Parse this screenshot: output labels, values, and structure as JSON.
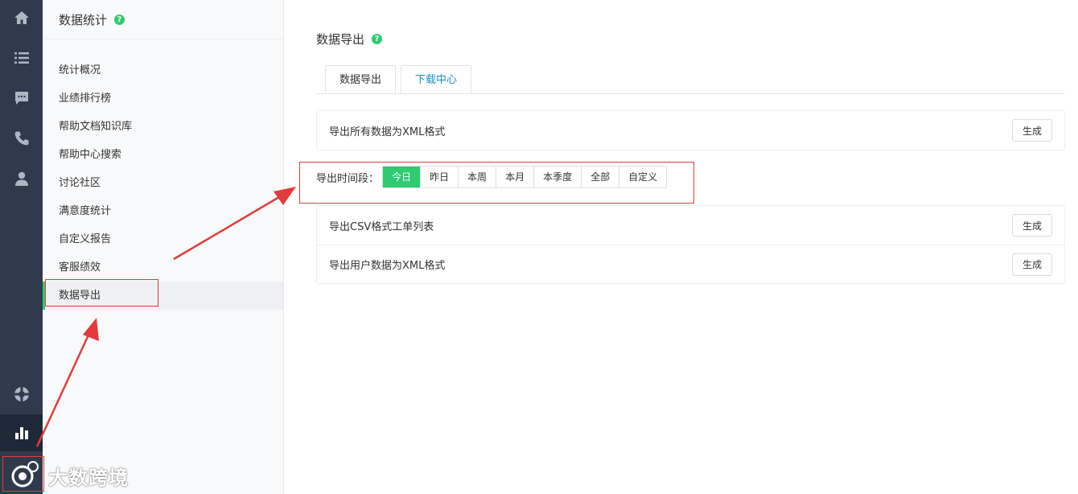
{
  "rail": {
    "icons": [
      "home-icon",
      "list-icon",
      "chat-icon",
      "phone-icon",
      "user-icon",
      "lifebuoy-icon",
      "bar-chart-icon"
    ],
    "active": "bar-chart-icon"
  },
  "sidebar": {
    "title": "数据统计",
    "help": "?",
    "items": [
      {
        "label": "统计概况"
      },
      {
        "label": "业绩排行榜"
      },
      {
        "label": "帮助文档知识库"
      },
      {
        "label": "帮助中心搜索"
      },
      {
        "label": "讨论社区"
      },
      {
        "label": "满意度统计"
      },
      {
        "label": "自定义报告"
      },
      {
        "label": "客服绩效"
      },
      {
        "label": "数据导出"
      }
    ],
    "active_index": 8
  },
  "main": {
    "title": "数据导出",
    "help": "?",
    "tabs": [
      {
        "label": "数据导出"
      },
      {
        "label": "下载中心"
      }
    ],
    "xml_all": {
      "label": "导出所有数据为XML格式",
      "button": "生成"
    },
    "period": {
      "label": "导出时间段：",
      "options": [
        "今日",
        "昨日",
        "本周",
        "本月",
        "本季度",
        "全部",
        "自定义"
      ],
      "selected": "今日"
    },
    "exports": [
      {
        "label": "导出CSV格式工单列表",
        "button": "生成"
      },
      {
        "label": "导出用户数据为XML格式",
        "button": "生成"
      }
    ]
  },
  "watermark": {
    "text": "大数跨境"
  },
  "colors": {
    "accent": "#2ecc71",
    "rail": "#2f3a4c",
    "link": "#1a8fc7",
    "annotation": "#e23b3b"
  }
}
